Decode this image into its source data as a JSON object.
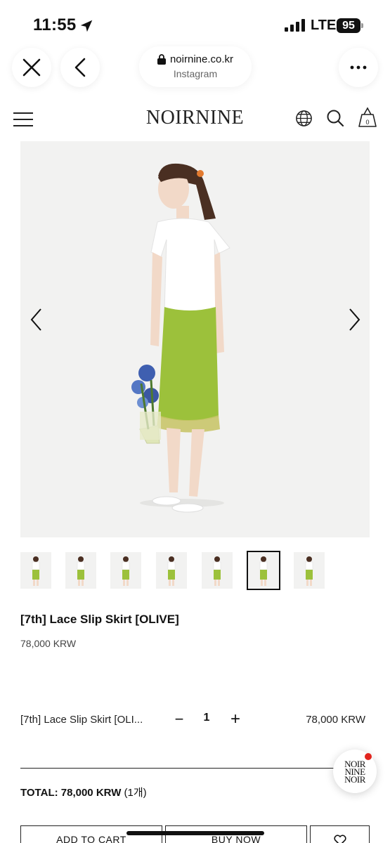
{
  "status_bar": {
    "time": "11:55",
    "network": "LTE",
    "battery": "95"
  },
  "browser": {
    "url": "noirnine.co.kr",
    "source": "Instagram"
  },
  "site": {
    "logo": "NOIRNINE"
  },
  "product": {
    "title": "[7th] Lace Slip Skirt [OLIVE]",
    "price": "78,000 KRW",
    "thumbnail_count": 7,
    "active_thumbnail": 6
  },
  "option": {
    "name": "[7th] Lace Slip Skirt [OLI...",
    "minus": "−",
    "quantity": "1",
    "plus": "+",
    "price": "78,000 KRW"
  },
  "total": {
    "label": "TOTAL: 78,000 KRW",
    "count": "(1개)"
  },
  "chat_badge": {
    "line1": "NOIR",
    "line2": "NINE",
    "line3": "NOIR"
  },
  "buttons": {
    "add_to_cart": "ADD TO CART",
    "buy_now": "BUY NOW"
  },
  "colors": {
    "accent": "#e2251e",
    "skirt": "#9cc13b",
    "text": "#111111"
  }
}
